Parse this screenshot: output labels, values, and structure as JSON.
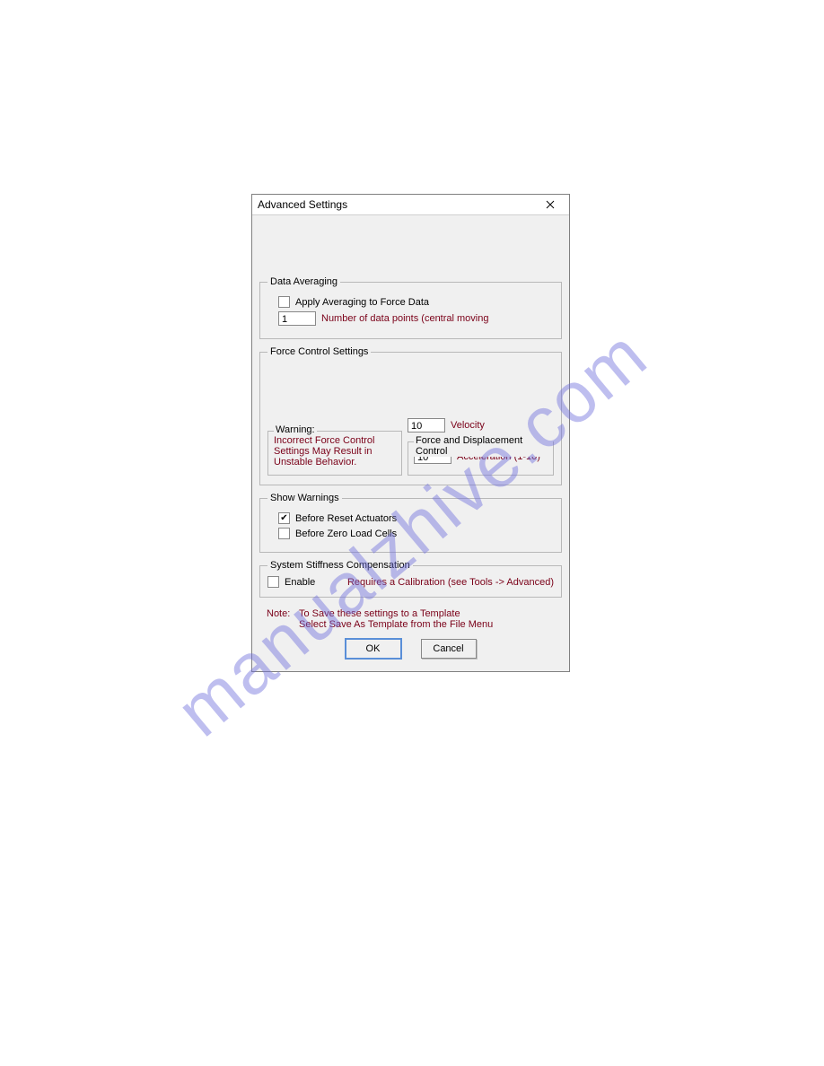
{
  "dialog": {
    "title": "Advanced Settings"
  },
  "averaging": {
    "legend": "Data Averaging",
    "apply_label": "Apply Averaging to Force Data",
    "points_value": "1",
    "points_label": "Number of data points (central moving"
  },
  "forceControl": {
    "legend": "Force Control Settings",
    "warning_legend": "Warning:",
    "warning_text": "Incorrect Force Control Settings May Result in Unstable Behavior.",
    "velocity_value": "10",
    "velocity_label": "Velocity",
    "fd_legend": "Force and Displacement Control",
    "accel_value": "10",
    "accel_label": "Acceleration (1-10)"
  },
  "warnings": {
    "legend": "Show Warnings",
    "reset_label": "Before Reset Actuators",
    "zero_label": "Before Zero Load Cells"
  },
  "stiffness": {
    "legend": "System Stiffness Compensation",
    "enable_label": "Enable",
    "note": "Requires a Calibration  (see Tools -> Advanced)"
  },
  "note": {
    "label": "Note:",
    "line1": "To Save these settings to a Template",
    "line2": "Select Save As Template from the File Menu"
  },
  "buttons": {
    "ok": "OK",
    "cancel": "Cancel"
  },
  "watermark": "manualzhive.com"
}
